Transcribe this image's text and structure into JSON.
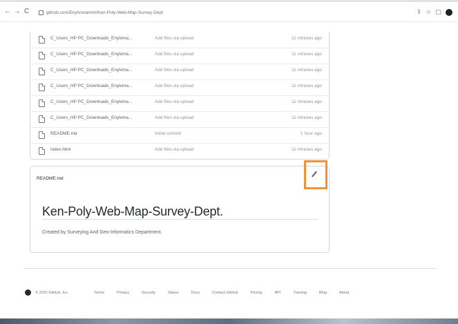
{
  "browser": {
    "back": "←",
    "forward": "→",
    "reload": "C",
    "url": "github.com/Enylvsnamim/Ken-Poly-Web-Map-Survey-Dept"
  },
  "files": [
    {
      "name": "C_Users_HP PC_Downloads_Enylvma...",
      "message": "Add files via upload",
      "time": "11 minutes ago"
    },
    {
      "name": "C_Users_HP PC_Downloads_Enylvma...",
      "message": "Add files via upload",
      "time": "11 minutes ago"
    },
    {
      "name": "C_Users_HP PC_Downloads_Enylvma...",
      "message": "Add files via upload",
      "time": "11 minutes ago"
    },
    {
      "name": "C_Users_HP PC_Downloads_Enylvma...",
      "message": "Add files via upload",
      "time": "11 minutes ago"
    },
    {
      "name": "C_Users_HP PC_Downloads_Enylvma...",
      "message": "Add files via upload",
      "time": "11 minutes ago"
    },
    {
      "name": "C_Users_HP PC_Downloads_Enylvma...",
      "message": "Add files via upload",
      "time": "11 minutes ago"
    },
    {
      "name": "README.md",
      "message": "Initial commit",
      "time": "1 hour ago"
    },
    {
      "name": "index.html",
      "message": "Add files via upload",
      "time": "11 minutes ago"
    }
  ],
  "readme": {
    "header": "README.md",
    "title": "Ken-Poly-Web-Map-Survey-Dept.",
    "description": "Created by Surveying And Geo-Informatics Department."
  },
  "footer": {
    "copyright": "© 2022 GitHub, Inc.",
    "links": [
      "Terms",
      "Privacy",
      "Security",
      "Status",
      "Docs",
      "Contact GitHub",
      "Pricing",
      "API",
      "Training",
      "Blog",
      "About"
    ]
  },
  "colors": {
    "highlight": "#f0913a"
  }
}
